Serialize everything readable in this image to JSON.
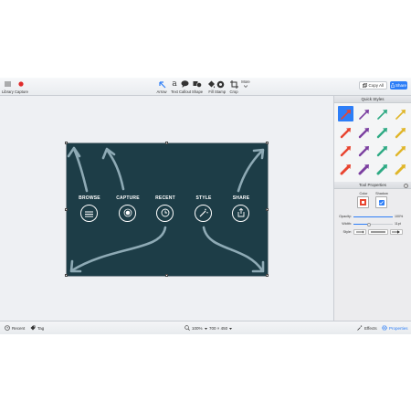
{
  "toolbar": {
    "library_label": "Library",
    "capture_label": "Capture",
    "tools": [
      {
        "label": "Arrow",
        "icon": "arrow-tool-icon"
      },
      {
        "label": "Text",
        "glyph": "a",
        "icon": "text-tool-icon"
      },
      {
        "label": "Callout",
        "icon": "callout-tool-icon"
      },
      {
        "label": "Shape",
        "icon": "shape-tool-icon"
      },
      {
        "label": "Fill",
        "icon": "fill-tool-icon"
      },
      {
        "label": "Stamp",
        "icon": "stamp-tool-icon"
      },
      {
        "label": "Crop",
        "icon": "crop-tool-icon"
      }
    ],
    "more_label": "More",
    "copy_all_label": "Copy All",
    "share_label": "Share"
  },
  "canvas": {
    "background_color": "#1d3d47",
    "captions": [
      "BROWSE",
      "CAPTURE",
      "RECENT",
      "STYLE",
      "SHARE"
    ]
  },
  "panel": {
    "quick_styles_title": "Quick Styles",
    "tool_properties_title": "Tool Properties",
    "help_glyph": "?",
    "color_label": "Color",
    "shadow_label": "Shadow",
    "opacity_label": "Opacity:",
    "opacity_value": "100%",
    "width_label": "Width:",
    "width_value": "11pt",
    "style_label": "Style:",
    "style_colors": [
      "#e8442f",
      "#7b3fa0",
      "#2eaa84",
      "#e0b62a"
    ]
  },
  "bottombar": {
    "recent_label": "Recent",
    "tag_label": "Tag",
    "zoom_value": "100%",
    "dimensions": "700 × 450",
    "effects_label": "Effects",
    "properties_label": "Properties"
  },
  "colors": {
    "accent": "#2d7ef7",
    "record": "#e02b2b"
  }
}
